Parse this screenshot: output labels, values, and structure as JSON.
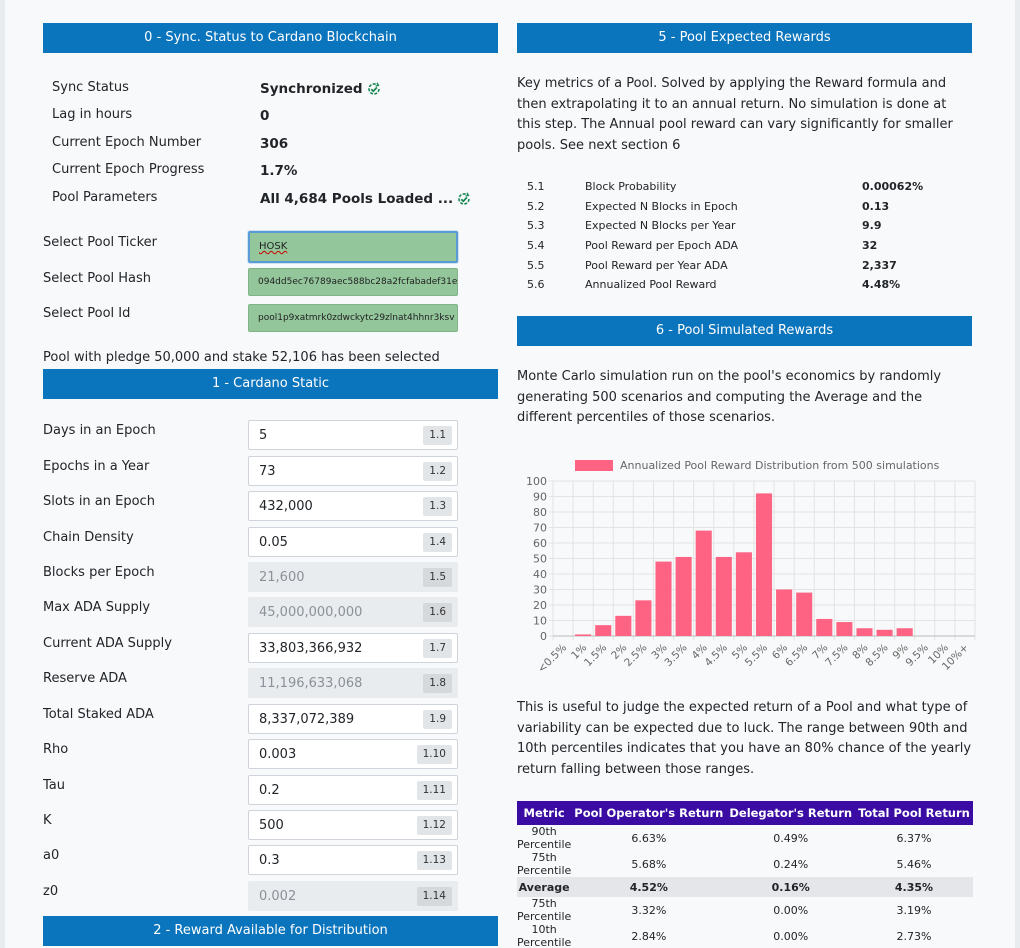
{
  "sections": {
    "s0": "0 - Sync. Status to Cardano Blockchain",
    "s1": "1 - Cardano Static",
    "s2": "2 - Reward Available for Distribution",
    "s5": "5 - Pool Expected Rewards",
    "s6": "6 - Pool Simulated Rewards"
  },
  "sync": [
    {
      "label": "Sync Status",
      "value": "Synchronized",
      "icon": "refresh-check-icon"
    },
    {
      "label": "Lag in hours",
      "value": "0"
    },
    {
      "label": "Current Epoch Number",
      "value": "306"
    },
    {
      "label": "Current Epoch Progress",
      "value": "1.7%"
    },
    {
      "label": "Pool Parameters",
      "value": "All 4,684 Pools Loaded ...",
      "icon": "refresh-check-icon"
    }
  ],
  "pool_select": [
    {
      "label": "Select Pool Ticker",
      "value": "HOSK"
    },
    {
      "label": "Select Pool Hash",
      "value": "094dd5ec76789aec588bc28a2fcfabadef31e"
    },
    {
      "label": "Select Pool Id",
      "value": "pool1p9xatmrk0zdwckytc29zlnat4hhnr3ksv"
    }
  ],
  "pool_selected_msg": "Pool with pledge 50,000 and stake 52,106 has been selected",
  "static_params": [
    {
      "label": "Days in an Epoch",
      "value": "5",
      "tag": "1.1",
      "readonly": false
    },
    {
      "label": "Epochs in a Year",
      "value": "73",
      "tag": "1.2",
      "readonly": false
    },
    {
      "label": "Slots in an Epoch",
      "value": "432,000",
      "tag": "1.3",
      "readonly": false
    },
    {
      "label": "Chain Density",
      "value": "0.05",
      "tag": "1.4",
      "readonly": false
    },
    {
      "label": "Blocks per Epoch",
      "value": "21,600",
      "tag": "1.5",
      "readonly": true
    },
    {
      "label": "Max ADA Supply",
      "value": "45,000,000,000",
      "tag": "1.6",
      "readonly": true
    },
    {
      "label": "Current ADA Supply",
      "value": "33,803,366,932",
      "tag": "1.7",
      "readonly": false
    },
    {
      "label": "Reserve ADA",
      "value": "11,196,633,068",
      "tag": "1.8",
      "readonly": true
    },
    {
      "label": "Total Staked ADA",
      "value": "8,337,072,389",
      "tag": "1.9",
      "readonly": false
    },
    {
      "label": "Rho",
      "value": "0.003",
      "tag": "1.10",
      "readonly": false
    },
    {
      "label": "Tau",
      "value": "0.2",
      "tag": "1.11",
      "readonly": false
    },
    {
      "label": "K",
      "value": "500",
      "tag": "1.12",
      "readonly": false
    },
    {
      "label": "a0",
      "value": "0.3",
      "tag": "1.13",
      "readonly": false
    },
    {
      "label": "z0",
      "value": "0.002",
      "tag": "1.14",
      "readonly": true
    }
  ],
  "expected_intro": "Key metrics of a Pool. Solved by applying the Reward formula and then extrapolating it to an annual return. No simulation is done at this step. The Annual pool reward can vary significantly for smaller pools. See next section 6",
  "key_metrics": [
    {
      "num": "5.1",
      "label": "Block Probability",
      "value": "0.00062%"
    },
    {
      "num": "5.2",
      "label": "Expected N Blocks in Epoch",
      "value": "0.13"
    },
    {
      "num": "5.3",
      "label": "Expected N Blocks per Year",
      "value": "9.9"
    },
    {
      "num": "5.4",
      "label": "Pool Reward per Epoch ADA",
      "value": "32"
    },
    {
      "num": "5.5",
      "label": "Pool Reward per Year ADA",
      "value": "2,337"
    },
    {
      "num": "5.6",
      "label": "Annualized Pool Reward",
      "value": "4.48%"
    }
  ],
  "sim_intro": "Monte Carlo simulation run on the pool's economics by randomly generating 500 scenarios and computing the Average and the different percentiles of those scenarios.",
  "chart_data": {
    "type": "bar",
    "title": "",
    "legend": "Annualized Pool Reward Distribution from 500 simulations",
    "legend_position": "top",
    "color": "#ff6384",
    "categories": [
      "<0.5%",
      "1%",
      "1.5%",
      "2%",
      "2.5%",
      "3%",
      "3.5%",
      "4%",
      "4.5%",
      "5%",
      "5.5%",
      "6%",
      "6.5%",
      "7%",
      "7.5%",
      "8%",
      "8.5%",
      "9%",
      "9.5%",
      "10%",
      "10%+"
    ],
    "values": [
      0,
      1,
      7,
      13,
      23,
      48,
      51,
      68,
      51,
      54,
      92,
      30,
      28,
      11,
      9,
      5,
      4,
      5,
      0,
      0,
      0
    ],
    "yticks": [
      "0",
      "10",
      "20",
      "30",
      "40",
      "50",
      "60",
      "70",
      "80",
      "90",
      "100"
    ],
    "ylim": [
      0,
      100
    ],
    "grid": true
  },
  "sim_outro": "This is useful to judge the expected return of a Pool and what type of variability can be expected due to luck. The range between 90th and 10th percentiles indicates that you have an 80% chance of the yearly return falling between those ranges.",
  "returns_table": {
    "headers": [
      "Metric",
      "Pool Operator's Return",
      "Delegator's Return",
      "Total Pool Return"
    ],
    "rows": [
      [
        "90th Percentile",
        "6.63%",
        "0.49%",
        "6.37%"
      ],
      [
        "75th Percentile",
        "5.68%",
        "0.24%",
        "5.46%"
      ],
      [
        "Average",
        "4.52%",
        "0.16%",
        "4.35%"
      ],
      [
        "75th Percentile",
        "3.32%",
        "0.00%",
        "3.19%"
      ],
      [
        "10th Percentile",
        "2.84%",
        "0.00%",
        "2.73%"
      ]
    ]
  },
  "colors": {
    "header": "#0a74bc",
    "table_header": "#3a0ca3",
    "select_bg": "#93c69b",
    "ok_icon": "#198754"
  }
}
